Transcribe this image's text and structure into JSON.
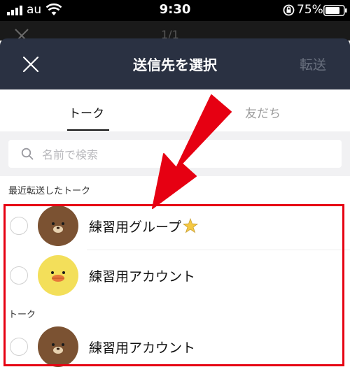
{
  "status_bar": {
    "carrier": "au",
    "time": "9:30",
    "battery_percent": "75%"
  },
  "behind_sheet": {
    "counter": "1/1"
  },
  "header": {
    "title": "送信先を選択",
    "forward_label": "転送",
    "close_icon": "close-icon"
  },
  "tabs": [
    {
      "label": "トーク",
      "active": true
    },
    {
      "label": "友だち",
      "active": false
    }
  ],
  "search": {
    "placeholder": "名前で検索",
    "value": ""
  },
  "sections": {
    "recent_label": "最近転送したトーク",
    "talk_label": "トーク"
  },
  "rows": [
    {
      "name": "練習用グループ",
      "avatar": "brown-bear-avatar",
      "badge": "sparkle-star-icon"
    },
    {
      "name": "練習用アカウント",
      "avatar": "sally-chick-avatar"
    },
    {
      "name": "練習用アカウント",
      "avatar": "brown-bear-avatar"
    }
  ],
  "colors": {
    "header_bg": "#2a3142",
    "highlight": "#e60012",
    "arrow": "#e60012"
  }
}
